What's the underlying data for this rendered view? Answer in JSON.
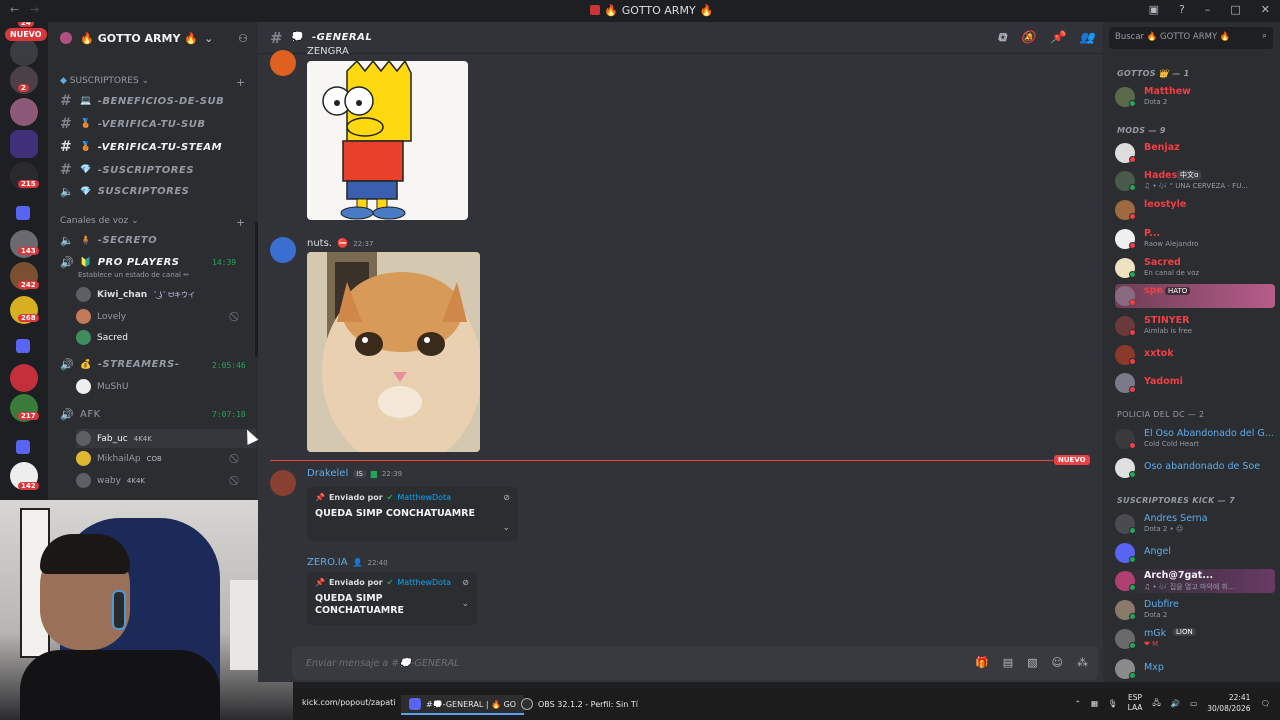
{
  "window": {
    "title": "GOTTO ARMY",
    "title_emoji_left": "🔥",
    "title_emoji_right": "🔥"
  },
  "servers": {
    "top_badge": "24",
    "nuevo_label": "NUEVO",
    "badges": [
      "2",
      "215",
      "143",
      "242",
      "268",
      "217",
      "142"
    ]
  },
  "guild": {
    "name": "GOTTO ARMY",
    "name_emoji_left": "🔥",
    "name_emoji_right": "🔥"
  },
  "channel_list": {
    "cat_subs": "SUSCRIPTORES",
    "text_channels": [
      {
        "name": "-BENEFICIOS-DE-SUB",
        "emoji": "💻"
      },
      {
        "name": "-VERIFICA-TU-SUB",
        "emoji": "🥉"
      },
      {
        "name": "-VERIFICA-TU-STEAM",
        "emoji": "🥉"
      },
      {
        "name": "-SUSCRIPTORES",
        "emoji": "💎"
      },
      {
        "name": "SUSCRIPTORES",
        "emoji": "💎"
      }
    ],
    "cat_voice": "Canales de voz",
    "voice": {
      "secreto": "-SECRETO",
      "pro_players": "PRO PLAYERS",
      "pro_timer": "14:39",
      "pro_status": "Establece un estado de canal ✏",
      "pro_users": [
        {
          "name": "Kiwi_chan",
          "tag": "˘ ͜ʖ˘  ᗢキウイ"
        },
        {
          "name": "Lovely",
          "tag": ""
        },
        {
          "name": "Sacred",
          "tag": ""
        }
      ],
      "streamers": "-STREAMERS-",
      "streamers_timer": "2:05:46",
      "streamers_users": [
        {
          "name": "MuShU"
        }
      ],
      "afk": "AFK",
      "afk_timer": "7:07:10",
      "afk_users": [
        {
          "name": "Fab_uc",
          "tag": "4K4K"
        },
        {
          "name": "MikhailAp",
          "tag": "COB"
        },
        {
          "name": "waby",
          "tag": "4K4K"
        }
      ]
    }
  },
  "chat": {
    "channel_name": "-GENERAL",
    "partial_author": "ZENGRA",
    "messages": [
      {
        "author": "nuts.",
        "time": "22:37"
      },
      {
        "author": "Drakelel",
        "badge": "IS",
        "time": "22:39"
      },
      {
        "author": "ZERO.IA",
        "time": "22:40"
      }
    ],
    "new_label": "NUEVO",
    "embed1": {
      "sent_by": "Enviado por",
      "who": "MatthewDota",
      "text": "QUEDA SIMP CONCHATUAMRE"
    },
    "embed2": {
      "sent_by": "Enviado por",
      "who": "MatthewDota",
      "text_line1": "QUEDA SIMP",
      "text_line2": "CONCHATUAMRE"
    },
    "composer_placeholder": "Enviar mensaje a #💭-GENERAL"
  },
  "members": {
    "search_placeholder": "Buscar 🔥 GOTTO ARMY 🔥",
    "groups": [
      {
        "label": "GOTTOS 👑 — 1"
      },
      {
        "label": "MODS — 9"
      },
      {
        "label": "POLICIA DEL DC — 2"
      },
      {
        "label": "SUSCRIPTORES KICK — 7"
      }
    ],
    "list": [
      {
        "name": "Matthew",
        "sub": "Dota 2",
        "color": "#f23f43",
        "status": "#23a55a"
      },
      {
        "name": "Benjaz",
        "sub": "",
        "color": "#f23f43",
        "status": "#f23f43"
      },
      {
        "name": "Hades",
        "sub": "♫ • 🎶 \" UNA CERVEZA - FU...",
        "color": "#f23f43",
        "status": "#23a55a"
      },
      {
        "name": "leostyle",
        "sub": "",
        "color": "#f23f43",
        "status": "#f23f43"
      },
      {
        "name": "P...",
        "sub": "Raow Alejandro",
        "color": "#f23f43",
        "status": "#f23f43"
      },
      {
        "name": "Sacred",
        "sub": "En canal de voz",
        "color": "#f23f43",
        "status": "#23a55a"
      },
      {
        "name": "spe",
        "sub": "",
        "color": "#f23f43",
        "status": "#f23f43"
      },
      {
        "name": "STINYER",
        "sub": "Aimlab is free",
        "color": "#f23f43",
        "status": "#f23f43"
      },
      {
        "name": "xxtok",
        "sub": "",
        "color": "#f23f43",
        "status": "#f23f43"
      },
      {
        "name": "Yadomi",
        "sub": "",
        "color": "#f23f43",
        "status": "#f23f43"
      },
      {
        "name": "El Oso Abandonado del G...",
        "sub": "Cold Cold Heart",
        "color": "#5dadec",
        "status": "#f23f43"
      },
      {
        "name": "Oso abandonado de Soe",
        "sub": "",
        "color": "#5dadec",
        "status": "#23a55a"
      },
      {
        "name": "Andres Serna",
        "sub": "Dota 2 • 😐",
        "color": "#5dadec",
        "status": "#23a55a"
      },
      {
        "name": "Angel",
        "sub": "",
        "color": "#5dadec",
        "status": "#23a55a"
      },
      {
        "name": "Arch@7gat...",
        "sub": "♫ • 🎶 집을 열고 마악에 취...",
        "color": "#f2f3f5",
        "status": "#23a55a"
      },
      {
        "name": "Dubfire",
        "sub": "Dota 2",
        "color": "#5dadec",
        "status": "#23a55a"
      },
      {
        "name": "mGk",
        "sub": "❤ M",
        "color": "#5dadec",
        "status": "#23a55a"
      },
      {
        "name": "Mxp",
        "sub": "",
        "color": "#5dadec",
        "status": "#23a55a"
      }
    ],
    "hades_tag": "中文ɑ",
    "spe_tag": "HATO",
    "mgk_tag": "LION"
  },
  "taskbar": {
    "item1": "kick.com/popout/zapati",
    "item2": "#💭-GENERAL | 🔥 GO",
    "item3": "OBS 32.1.2 - Perfil: Sin Tí",
    "lang1": "ESP",
    "lang2": "LAA",
    "time": "22:41",
    "date": "30/08/2026"
  }
}
